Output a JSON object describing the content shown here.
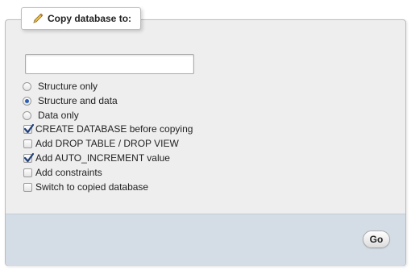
{
  "fieldset": {
    "legend": "Copy database to:",
    "legend_icon": "pencil-icon"
  },
  "new_db_name": {
    "value": "",
    "placeholder": ""
  },
  "copy_mode": {
    "options": [
      {
        "label": "Structure only",
        "selected": false
      },
      {
        "label": "Structure and data",
        "selected": true
      },
      {
        "label": "Data only",
        "selected": false
      }
    ]
  },
  "options": [
    {
      "label": "CREATE DATABASE before copying",
      "checked": true
    },
    {
      "label": "Add DROP TABLE / DROP VIEW",
      "checked": false
    },
    {
      "label": "Add AUTO_INCREMENT value",
      "checked": true
    },
    {
      "label": "Add constraints",
      "checked": false
    },
    {
      "label": "Switch to copied database",
      "checked": false
    }
  ],
  "footer": {
    "go_label": "Go"
  },
  "colors": {
    "panel_bg": "#eeeeee",
    "footer_bg": "#d4dde6",
    "radio_selected": "#2d5fb3",
    "checkmark": "#1f3f7a"
  }
}
